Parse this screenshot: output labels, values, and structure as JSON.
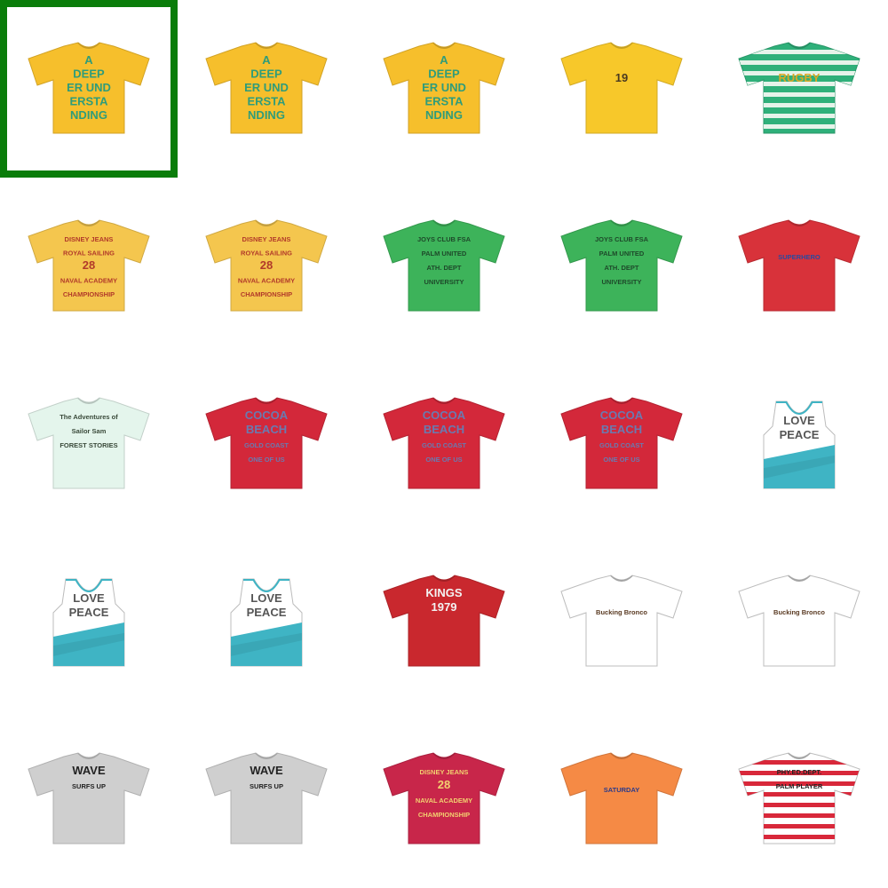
{
  "grid": {
    "columns": 5,
    "rows": 5,
    "selected_index": 0,
    "selection_color": "#0a7d0a",
    "items": [
      {
        "color": "#f6bf2c",
        "style": "tee",
        "print": [
          "A",
          "DEEP",
          "ER UND",
          "ERSTA",
          "NDING"
        ],
        "print_color": "#2f9c7a"
      },
      {
        "color": "#f6bf2c",
        "style": "tee",
        "print": [
          "A",
          "DEEP",
          "ER UND",
          "ERSTA",
          "NDING"
        ],
        "print_color": "#2f9c7a"
      },
      {
        "color": "#f6bf2c",
        "style": "tee",
        "print": [
          "A",
          "DEEP",
          "ER UND",
          "ERSTA",
          "NDING"
        ],
        "print_color": "#2f9c7a"
      },
      {
        "color": "#f7c82a",
        "style": "tee",
        "print": [
          "19"
        ],
        "print_color": "#4a3a20"
      },
      {
        "color": "#2fb07a",
        "style": "stripes",
        "stripe": "#e6f3ea",
        "print": [
          "RUGBY"
        ],
        "print_color": "#d9a825"
      },
      {
        "color": "#f4c64e",
        "style": "tee",
        "print": [
          "DISNEY JEANS",
          "ROYAL SAILING",
          "28",
          "NAVAL ACADEMY",
          "CHAMPIONSHIP"
        ],
        "print_color": "#b23a2a"
      },
      {
        "color": "#f4c64e",
        "style": "tee",
        "print": [
          "DISNEY JEANS",
          "ROYAL SAILING",
          "28",
          "NAVAL ACADEMY",
          "CHAMPIONSHIP"
        ],
        "print_color": "#b23a2a"
      },
      {
        "color": "#3db35a",
        "style": "tee",
        "print": [
          "JOYS CLUB FSA",
          "PALM UNITED",
          "ATH. DEPT",
          "UNIVERSITY"
        ],
        "print_color": "#1e4a2a"
      },
      {
        "color": "#3db35a",
        "style": "tee",
        "print": [
          "JOYS CLUB FSA",
          "PALM UNITED",
          "ATH. DEPT",
          "UNIVERSITY"
        ],
        "print_color": "#1e4a2a"
      },
      {
        "color": "#d8323a",
        "style": "tee",
        "print": [
          "SUPERHERO"
        ],
        "print_color": "#2a4aa0"
      },
      {
        "color": "#e4f5ec",
        "style": "tee",
        "print": [
          "The Adventures of",
          "Sailor Sam",
          "FOREST STORIES"
        ],
        "print_color": "#3a4a3a"
      },
      {
        "color": "#d3283a",
        "style": "tee",
        "print": [
          "COCOA",
          "BEACH",
          "GOLD COAST",
          "ONE OF US"
        ],
        "print_color": "#6a7ab0"
      },
      {
        "color": "#d3283a",
        "style": "tee",
        "print": [
          "COCOA",
          "BEACH",
          "GOLD COAST",
          "ONE OF US"
        ],
        "print_color": "#6a7ab0"
      },
      {
        "color": "#d3283a",
        "style": "tee",
        "print": [
          "COCOA",
          "BEACH",
          "GOLD COAST",
          "ONE OF US"
        ],
        "print_color": "#6a7ab0"
      },
      {
        "color": "#ffffff",
        "style": "tank",
        "accent": "#3fb4c4",
        "print": [
          "LOVE",
          "PEACE"
        ],
        "print_color": "#555555"
      },
      {
        "color": "#ffffff",
        "style": "tank",
        "accent": "#3fb4c4",
        "print": [
          "LOVE",
          "PEACE"
        ],
        "print_color": "#555555"
      },
      {
        "color": "#ffffff",
        "style": "tank",
        "accent": "#3fb4c4",
        "print": [
          "LOVE",
          "PEACE"
        ],
        "print_color": "#555555"
      },
      {
        "color": "#c9282e",
        "style": "tee",
        "print": [
          "KINGS",
          "1979"
        ],
        "print_color": "#f3f3f3"
      },
      {
        "color": "#ffffff",
        "style": "tee",
        "print": [
          "Bucking Bronco"
        ],
        "print_color": "#5a3a22"
      },
      {
        "color": "#ffffff",
        "style": "tee",
        "print": [
          "Bucking Bronco"
        ],
        "print_color": "#5a3a22"
      },
      {
        "color": "#cfcfcf",
        "style": "tee",
        "print": [
          "WAVE",
          "SURFS UP"
        ],
        "print_color": "#222222"
      },
      {
        "color": "#cfcfcf",
        "style": "tee",
        "print": [
          "WAVE",
          "SURFS UP"
        ],
        "print_color": "#222222"
      },
      {
        "color": "#c8264a",
        "style": "tee",
        "print": [
          "DISNEY JEANS",
          "28",
          "NAVAL ACADEMY",
          "CHAMPIONSHIP"
        ],
        "print_color": "#f2d070"
      },
      {
        "color": "#f58a45",
        "style": "tee",
        "print": [
          "SATURDAY"
        ],
        "print_color": "#2a3a8a"
      },
      {
        "color": "#ffffff",
        "style": "stripes",
        "stripe": "#d8283a",
        "print": [
          "PHY.ED.DEPT.",
          "PALM PLAYER"
        ],
        "print_color": "#222222"
      }
    ]
  }
}
